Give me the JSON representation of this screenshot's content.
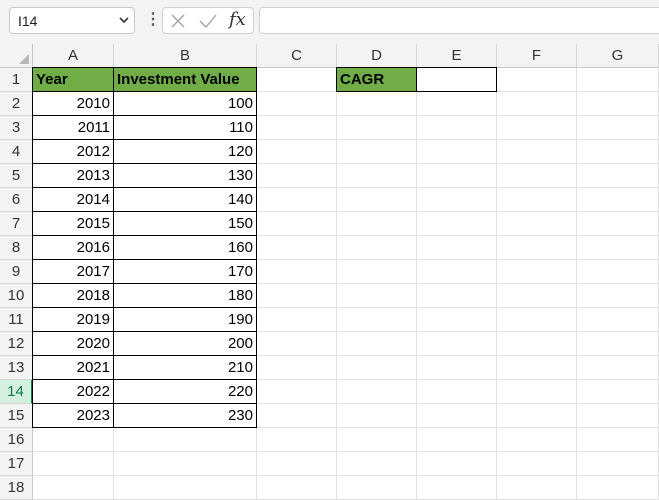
{
  "formula_bar": {
    "name_box": "I14",
    "dropdown_icon": "chevron-down-icon",
    "menu_icon": "more-vertical-icon",
    "cancel_icon": "close-icon",
    "enter_icon": "check-icon",
    "fx_label": "fx",
    "formula": ""
  },
  "columns": [
    "A",
    "B",
    "C",
    "D",
    "E",
    "F",
    "G"
  ],
  "rows": [
    "1",
    "2",
    "3",
    "4",
    "5",
    "6",
    "7",
    "8",
    "9",
    "10",
    "11",
    "12",
    "13",
    "14",
    "15",
    "16",
    "17",
    "18"
  ],
  "active_row": "14",
  "table": {
    "headers": [
      "Year",
      "Investment Value"
    ],
    "rows": [
      [
        "2010",
        "100"
      ],
      [
        "2011",
        "110"
      ],
      [
        "2012",
        "120"
      ],
      [
        "2013",
        "130"
      ],
      [
        "2014",
        "140"
      ],
      [
        "2015",
        "150"
      ],
      [
        "2016",
        "160"
      ],
      [
        "2017",
        "170"
      ],
      [
        "2018",
        "180"
      ],
      [
        "2019",
        "190"
      ],
      [
        "2020",
        "200"
      ],
      [
        "2021",
        "210"
      ],
      [
        "2022",
        "220"
      ],
      [
        "2023",
        "230"
      ]
    ]
  },
  "cagr": {
    "label": "CAGR",
    "value": ""
  },
  "colors": {
    "header_fill": "#70ad47",
    "active_row_highlight": "#107c41"
  }
}
